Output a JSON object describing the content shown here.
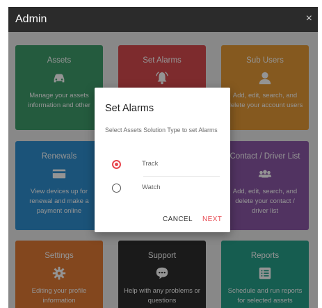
{
  "window": {
    "title": "Admin",
    "close_glyph": "×"
  },
  "tiles": [
    {
      "name": "Assets",
      "icon": "car-icon",
      "desc": "Manage your assets information and other",
      "color": "#3e9d6b"
    },
    {
      "name": "Set Alarms",
      "icon": "bell-icon",
      "desc": "",
      "color": "#d84a4f"
    },
    {
      "name": "Sub Users",
      "icon": "user-icon",
      "desc": "Add, edit, search, and delete your account users",
      "color": "#e59a36"
    },
    {
      "name": "Renewals",
      "icon": "card-icon",
      "desc": "View devices up for renewal and make a payment online",
      "color": "#2f8fd0"
    },
    {
      "name": "Contact / Driver List",
      "icon": "users-icon",
      "desc": "Add, edit, search, and delete your contact / driver list",
      "color": "#8c59a8"
    },
    {
      "name": "Settings",
      "icon": "gear-icon",
      "desc": "Editing your profile information",
      "color": "#e27a35"
    },
    {
      "name": "Support",
      "icon": "chat-icon",
      "desc": "Help with any problems or questions",
      "color": "#2d2d2d"
    },
    {
      "name": "Reports",
      "icon": "report-icon",
      "desc": "Schedule and run reports for selected assets",
      "color": "#27a08a"
    }
  ],
  "dialog": {
    "title": "Set Alarms",
    "subtitle": "Select Assets Solution Type to set Alarms",
    "options": [
      {
        "label": "Track",
        "selected": true
      },
      {
        "label": "Watch",
        "selected": false
      }
    ],
    "cancel_label": "CANCEL",
    "next_label": "NEXT",
    "accent": "#e8474f"
  }
}
